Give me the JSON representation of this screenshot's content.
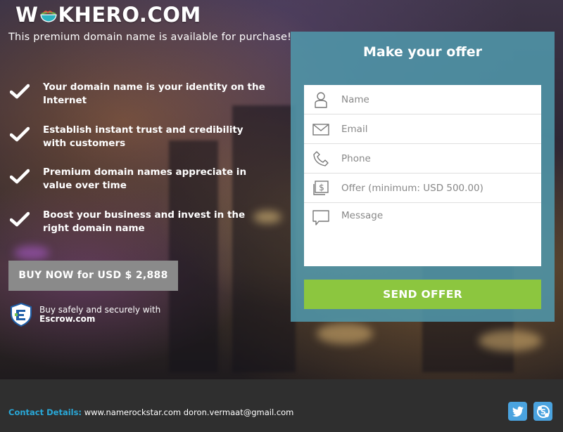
{
  "brand": {
    "logo_left": "W",
    "logo_right": "KHERO.COM"
  },
  "tagline": "This premium domain name is available for purchase!",
  "benefits": [
    {
      "icon": "check-icon",
      "text": "Your domain name is your identity on the Internet"
    },
    {
      "icon": "check-icon",
      "text": "Establish instant trust and credibility with customers"
    },
    {
      "icon": "check-icon",
      "text": "Premium domain names appreciate in value over time"
    },
    {
      "icon": "check-icon",
      "text": "Boost your business and invest in the right domain name"
    }
  ],
  "buy_button": "BUY NOW for USD $ 2,888",
  "escrow": {
    "line1": "Buy safely and securely with",
    "brand": "Escrow.com"
  },
  "offer": {
    "title": "Make your offer",
    "fields": [
      {
        "icon": "user-icon",
        "placeholder": "Name"
      },
      {
        "icon": "envelope-icon",
        "placeholder": "Email"
      },
      {
        "icon": "phone-icon",
        "placeholder": "Phone"
      },
      {
        "icon": "dollar-icon",
        "placeholder": "Offer (minimum: USD 500.00)"
      },
      {
        "icon": "message-icon",
        "placeholder": "Message"
      }
    ],
    "submit": "SEND OFFER"
  },
  "footer": {
    "contact_label": "Contact Details:",
    "contact_value": " www.namerockstar.com doron.vermaat@gmail.com",
    "social": [
      "twitter-icon",
      "skype-icon"
    ]
  },
  "colors": {
    "panel": "#5096aa",
    "send_button": "#8cc63f",
    "buy_button": "#8a8a8a",
    "contact_label": "#29a8d8",
    "social": "#4aa3df"
  }
}
